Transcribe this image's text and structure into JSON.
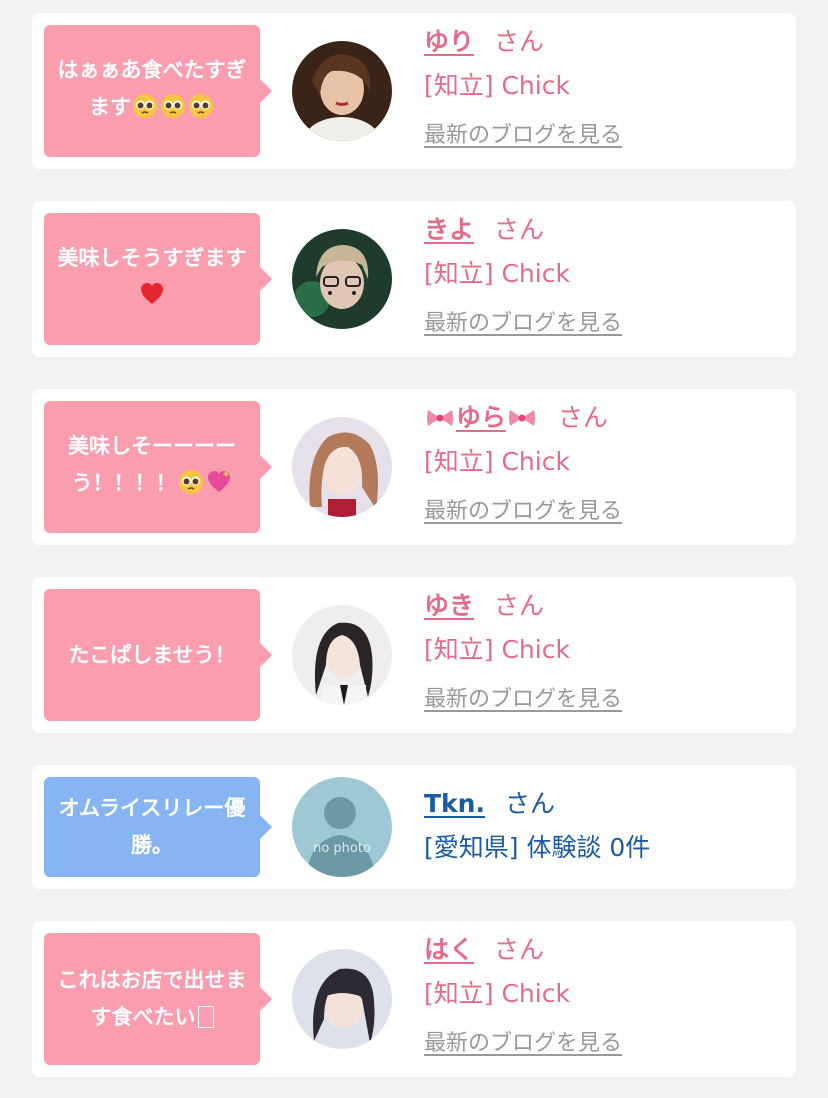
{
  "colors": {
    "pink_accent": "#e46b89",
    "pink_bubble": "#f99daf",
    "blue_accent": "#1a5ba6",
    "blue_bubble": "#87b5f2",
    "link_gray": "#999999"
  },
  "cards": [
    {
      "comment": "はぁぁあ食べたすぎます",
      "comment_emojis": [
        "pleading-face",
        "pleading-face",
        "pleading-face"
      ],
      "name": "ゆり",
      "honorific": "さん",
      "location": "[知立] Chick",
      "link": "最新のブログを見る"
    },
    {
      "comment": "美味しそうすぎます",
      "comment_emojis": [
        "red-heart"
      ],
      "name": "きよ",
      "honorific": "さん",
      "location": "[知立] Chick",
      "link": "最新のブログを見る"
    },
    {
      "comment": "美味しそーーーーう！！！！",
      "comment_emojis": [
        "pleading-face",
        "sparkling-heart"
      ],
      "name": "ゆら",
      "name_emojis": [
        "ribbon",
        "ribbon"
      ],
      "honorific": "さん",
      "location": "[知立] Chick",
      "link": "最新のブログを見る"
    },
    {
      "comment": "たこぱしませう！",
      "name": "ゆき",
      "honorific": "さん",
      "location": "[知立] Chick",
      "link": "最新のブログを見る"
    },
    {
      "comment": "オムライスリレー優勝。",
      "name": "Tkn.",
      "honorific": "さん",
      "location": "[愛知県] 体験談 0件",
      "avatar_text": "no photo"
    },
    {
      "comment": "これはお店で出せます食べたい",
      "comment_emojis": [
        "missing-glyph"
      ],
      "name": "はく",
      "honorific": "さん",
      "location": "[知立] Chick",
      "link": "最新のブログを見る"
    }
  ]
}
